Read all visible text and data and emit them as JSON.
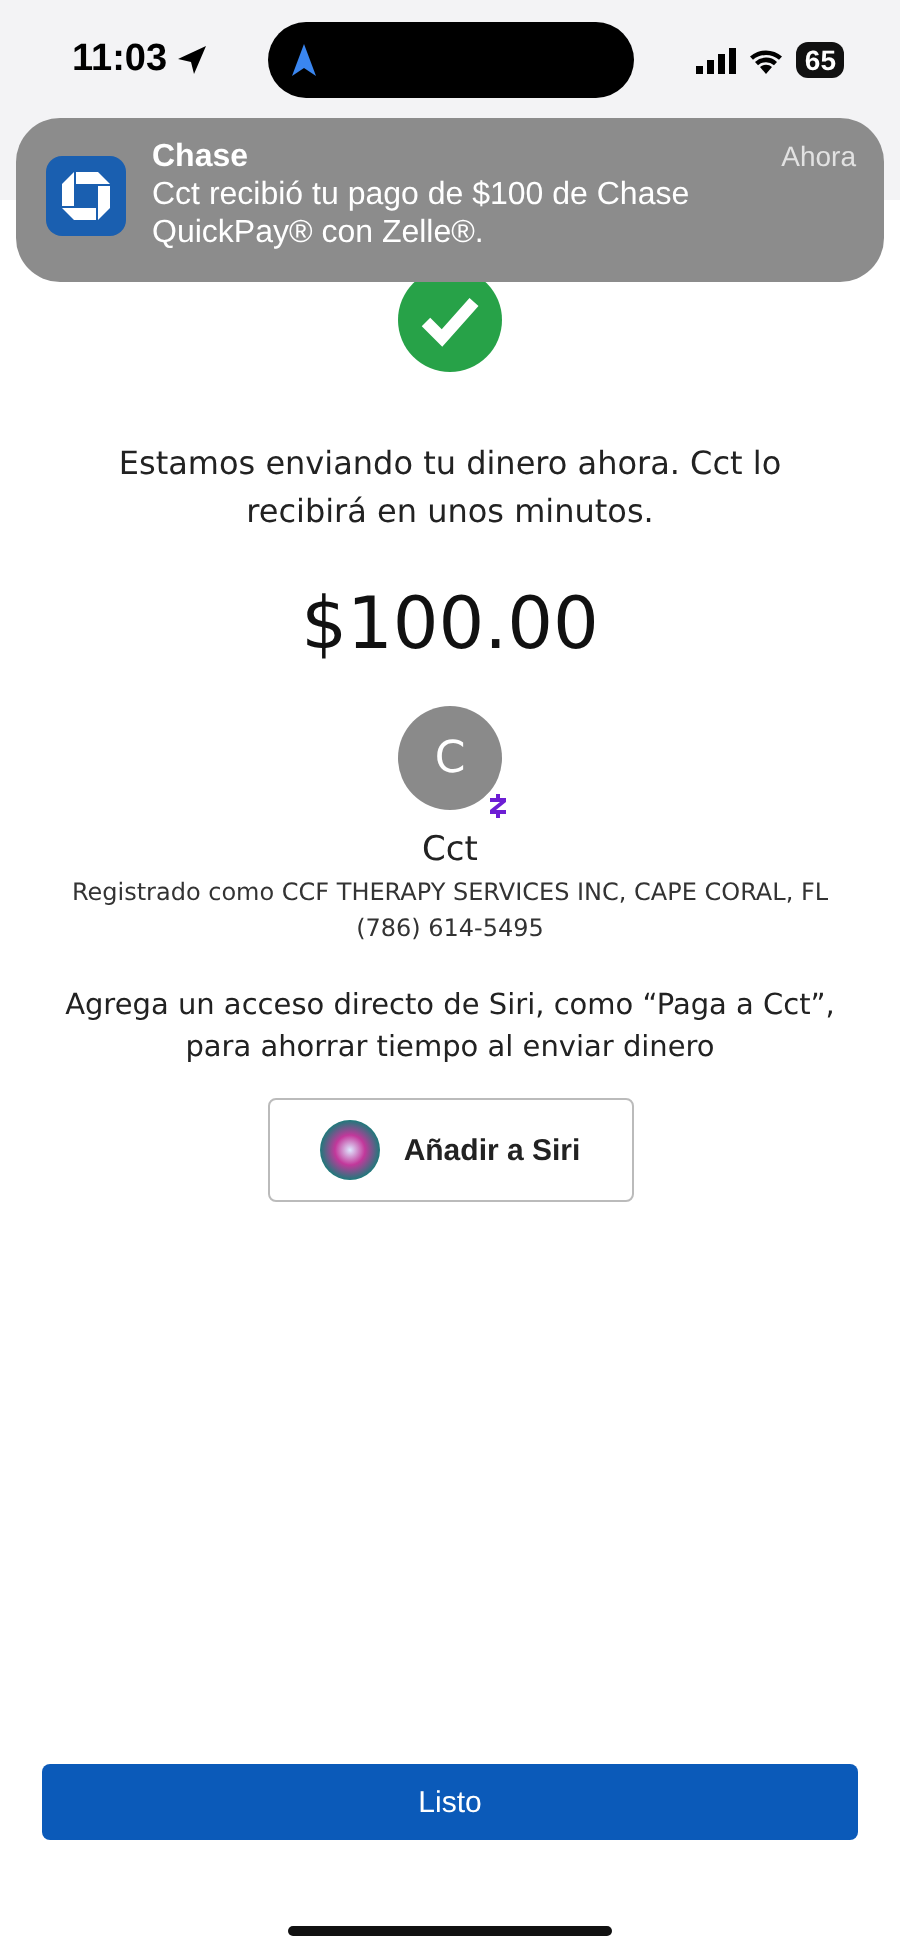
{
  "status_bar": {
    "time": "11:03",
    "battery": "65"
  },
  "notification": {
    "app": "Chase",
    "time": "Ahora",
    "message": "Cct recibió tu pago de $100 de Chase QuickPay® con Zelle®."
  },
  "confirmation": {
    "message": "Estamos enviando tu dinero ahora. Cct lo recibirá en unos minutos.",
    "amount": "$100.00"
  },
  "recipient": {
    "initial": "C",
    "name": "Cct",
    "registered": "Registrado como CCF THERAPY SERVICES INC, CAPE CORAL, FL",
    "phone": "(786) 614-5495"
  },
  "siri": {
    "text": "Agrega un acceso directo de Siri, como “Paga a Cct”, para ahorrar tiempo al enviar dinero",
    "button": "Añadir a Siri"
  },
  "done_button": "Listo"
}
